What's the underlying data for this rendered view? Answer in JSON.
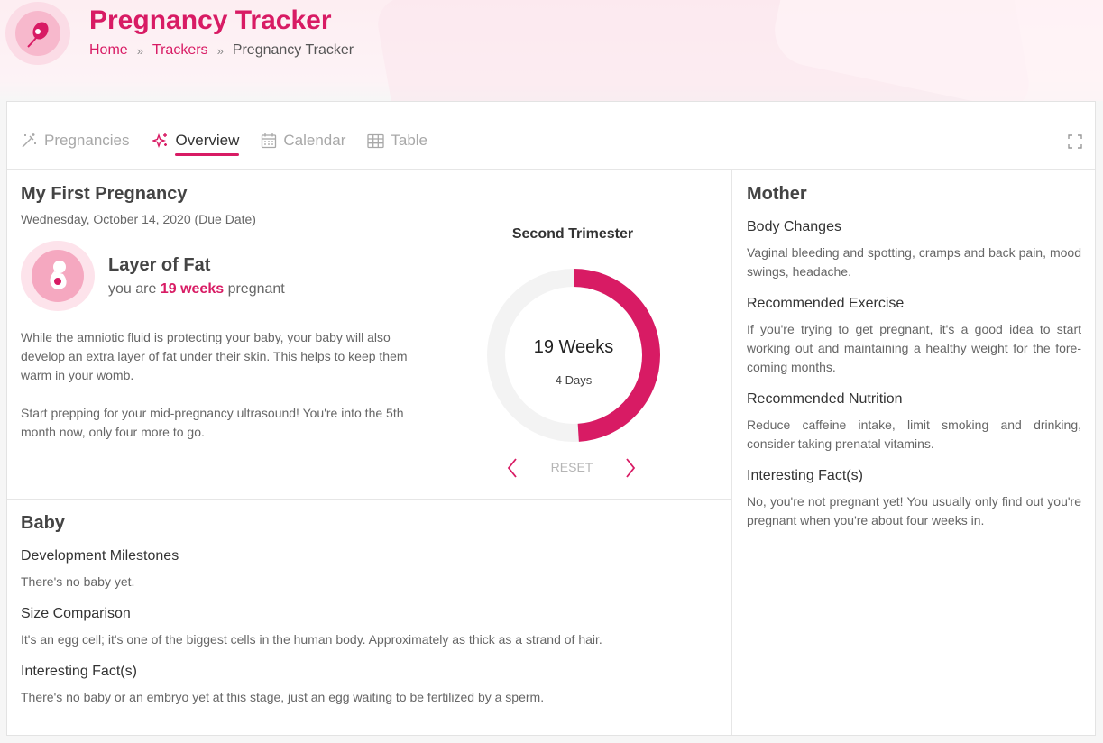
{
  "header": {
    "title": "Pregnancy Tracker",
    "breadcrumb": {
      "home": "Home",
      "trackers": "Trackers",
      "current": "Pregnancy Tracker",
      "separator": "»"
    }
  },
  "colors": {
    "accent": "#d81b64",
    "ring_track": "#f3f3f3"
  },
  "tabs": [
    {
      "label": "Pregnancies",
      "icon": "magic-wand-icon",
      "active": false
    },
    {
      "label": "Overview",
      "icon": "sparkles-icon",
      "active": true
    },
    {
      "label": "Calendar",
      "icon": "calendar-icon",
      "active": false
    },
    {
      "label": "Table",
      "icon": "table-icon",
      "active": false
    }
  ],
  "overview": {
    "pregnancy_name": "My First Pregnancy",
    "due_date": "Wednesday, October 14, 2020 (Due Date)",
    "stage_title": "Layer of Fat",
    "stage_prefix": "you are",
    "stage_weeks": "19 weeks",
    "stage_suffix": "pregnant",
    "paragraph_1": "While the amniotic fluid is protecting your baby, your baby will also develop an extra layer of fat under their skin. This helps to keep them warm in your womb.",
    "paragraph_2": "Start prepping for your mid-pregnancy ultrasound! You're into the 5th month now, only four more to go."
  },
  "progress": {
    "trimester": "Second Trimester",
    "weeks_label": "19 Weeks",
    "days_label": "4 Days",
    "fraction": 0.49,
    "reset_label": "RESET"
  },
  "baby": {
    "title": "Baby",
    "milestones_head": "Development Milestones",
    "milestones_text": "There's no baby yet.",
    "size_head": "Size Comparison",
    "size_text": "It's an egg cell; it's one of the biggest cells in the human body. Approximately as thick as a strand of hair.",
    "facts_head": "Interesting Fact(s)",
    "facts_text": "There's no baby or an embryo yet at this stage, just an egg waiting to be fertilized by a sperm."
  },
  "mother": {
    "title": "Mother",
    "body_head": "Body Changes",
    "body_text": "Vaginal bleeding and spotting, cramps and back pain, mood swings, headache.",
    "exercise_head": "Recommended Exercise",
    "exercise_text": "If you're trying to get pregnant, it's a good idea to start working out and maintaining a healthy weight for the fore-coming months.",
    "nutrition_head": "Recommended Nutrition",
    "nutrition_text": "Reduce caffeine intake, limit smoking and drinking, consider taking prenatal vitamins.",
    "facts_head": "Interesting Fact(s)",
    "facts_text": "No, you're not pregnant yet! You usually only find out you're pregnant when you're about four weeks in."
  }
}
